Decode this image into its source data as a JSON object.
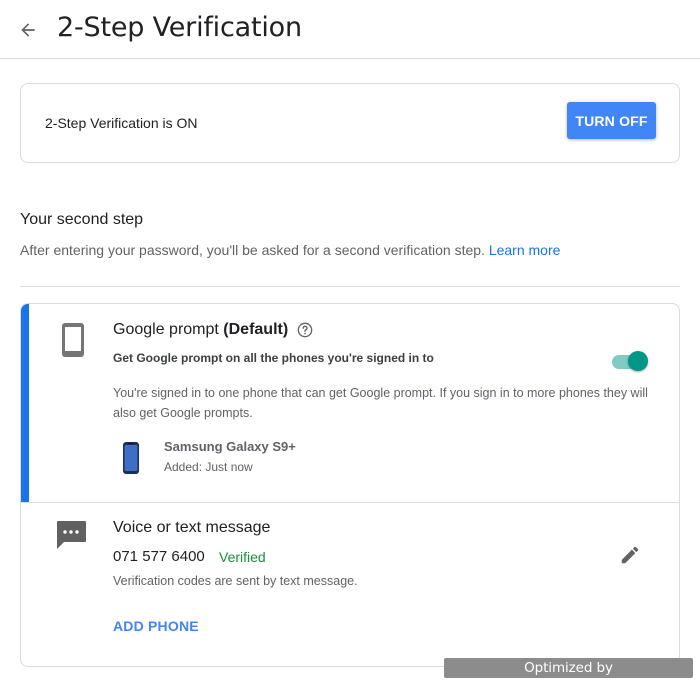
{
  "header": {
    "title": "2-Step Verification",
    "back_icon": "arrow-back-icon"
  },
  "status": {
    "text": "2-Step Verification is ON",
    "button_label": "TURN OFF",
    "button_color": "#4285f4"
  },
  "second_step": {
    "title": "Your second step",
    "description": "After entering your password, you'll be asked for a second verification step.",
    "learn_more": "Learn more"
  },
  "google_prompt": {
    "title": "Google prompt",
    "title_suffix": "(Default)",
    "subtitle": "Get Google prompt on all the phones you're signed in to",
    "toggle_on": true,
    "description": "You're signed in to one phone that can get Google prompt. If you sign in to more phones they will also get Google prompts.",
    "device_name": "Samsung Galaxy S9+",
    "device_added": "Added: Just now",
    "accent_color": "#1a73e8",
    "toggle_color": "#009688"
  },
  "sms": {
    "title": "Voice or text message",
    "phone_number": "071 577 6400",
    "verified_label": "Verified",
    "description": "Verification codes are sent by text message.",
    "add_phone_label": "ADD PHONE",
    "verified_color": "#1e8e3e"
  },
  "watermark": {
    "text": "Optimized by www.ImageOptimizer.net"
  }
}
